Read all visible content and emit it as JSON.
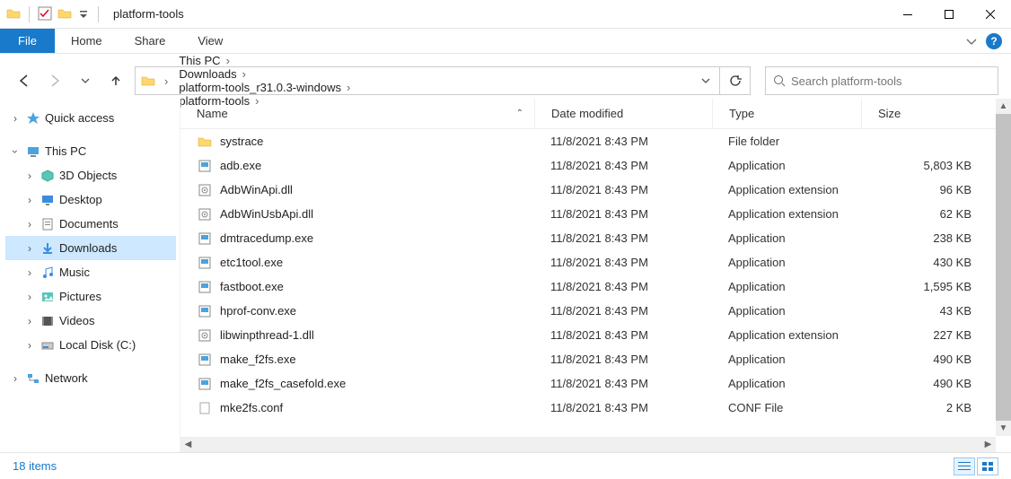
{
  "window": {
    "title": "platform-tools"
  },
  "ribbon": {
    "file": "File",
    "tabs": [
      "Home",
      "Share",
      "View"
    ]
  },
  "breadcrumb": [
    "This PC",
    "Downloads",
    "platform-tools_r31.0.3-windows",
    "platform-tools"
  ],
  "search": {
    "placeholder": "Search platform-tools"
  },
  "columns": {
    "name": "Name",
    "date": "Date modified",
    "type": "Type",
    "size": "Size"
  },
  "sidebar": {
    "quick_access": "Quick access",
    "this_pc": "This PC",
    "children": [
      {
        "label": "3D Objects",
        "icon": "cube"
      },
      {
        "label": "Desktop",
        "icon": "desktop"
      },
      {
        "label": "Documents",
        "icon": "doc"
      },
      {
        "label": "Downloads",
        "icon": "download",
        "selected": true
      },
      {
        "label": "Music",
        "icon": "music"
      },
      {
        "label": "Pictures",
        "icon": "picture"
      },
      {
        "label": "Videos",
        "icon": "video"
      },
      {
        "label": "Local Disk (C:)",
        "icon": "disk"
      }
    ],
    "network": "Network"
  },
  "files": [
    {
      "name": "systrace",
      "date": "11/8/2021 8:43 PM",
      "type": "File folder",
      "size": "",
      "icon": "folder"
    },
    {
      "name": "adb.exe",
      "date": "11/8/2021 8:43 PM",
      "type": "Application",
      "size": "5,803 KB",
      "icon": "exe"
    },
    {
      "name": "AdbWinApi.dll",
      "date": "11/8/2021 8:43 PM",
      "type": "Application extension",
      "size": "96 KB",
      "icon": "dll"
    },
    {
      "name": "AdbWinUsbApi.dll",
      "date": "11/8/2021 8:43 PM",
      "type": "Application extension",
      "size": "62 KB",
      "icon": "dll"
    },
    {
      "name": "dmtracedump.exe",
      "date": "11/8/2021 8:43 PM",
      "type": "Application",
      "size": "238 KB",
      "icon": "exe"
    },
    {
      "name": "etc1tool.exe",
      "date": "11/8/2021 8:43 PM",
      "type": "Application",
      "size": "430 KB",
      "icon": "exe"
    },
    {
      "name": "fastboot.exe",
      "date": "11/8/2021 8:43 PM",
      "type": "Application",
      "size": "1,595 KB",
      "icon": "exe"
    },
    {
      "name": "hprof-conv.exe",
      "date": "11/8/2021 8:43 PM",
      "type": "Application",
      "size": "43 KB",
      "icon": "exe"
    },
    {
      "name": "libwinpthread-1.dll",
      "date": "11/8/2021 8:43 PM",
      "type": "Application extension",
      "size": "227 KB",
      "icon": "dll"
    },
    {
      "name": "make_f2fs.exe",
      "date": "11/8/2021 8:43 PM",
      "type": "Application",
      "size": "490 KB",
      "icon": "exe"
    },
    {
      "name": "make_f2fs_casefold.exe",
      "date": "11/8/2021 8:43 PM",
      "type": "Application",
      "size": "490 KB",
      "icon": "exe"
    },
    {
      "name": "mke2fs.conf",
      "date": "11/8/2021 8:43 PM",
      "type": "CONF File",
      "size": "2 KB",
      "icon": "file"
    }
  ],
  "status": {
    "count": "18 items"
  }
}
